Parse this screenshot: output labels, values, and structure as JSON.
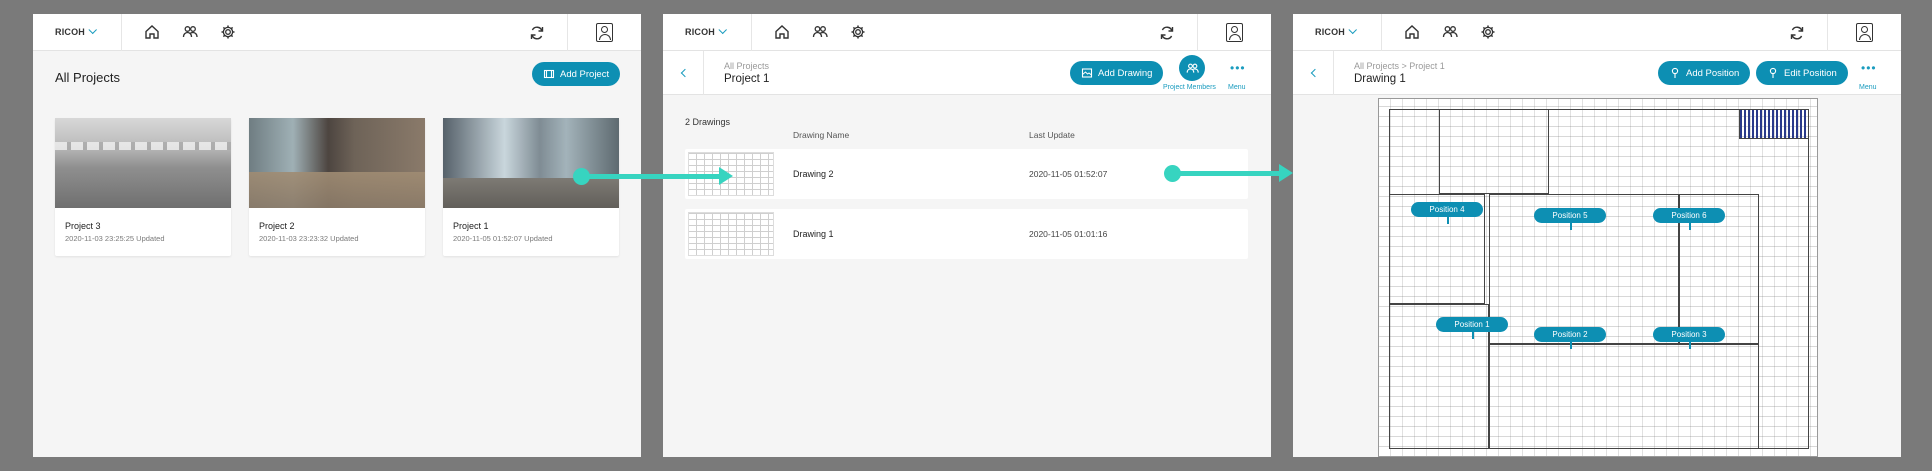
{
  "brand": "RICOH",
  "colors": {
    "accent": "#0d8fb3",
    "arrow": "#37d4c0"
  },
  "screen1": {
    "title": "All Projects",
    "add_project": "Add Project",
    "projects": [
      {
        "name": "Project 3",
        "updated": "2020-11-03 23:25:25 Updated"
      },
      {
        "name": "Project 2",
        "updated": "2020-11-03 23:23:32 Updated"
      },
      {
        "name": "Project 1",
        "updated": "2020-11-05 01:52:07 Updated"
      }
    ]
  },
  "screen2": {
    "breadcrumb": "All Projects",
    "title": "Project 1",
    "add_drawing": "Add Drawing",
    "project_members": "Project Members",
    "menu": "Menu",
    "count": "2 Drawings",
    "col_name": "Drawing Name",
    "col_update": "Last Update",
    "drawings": [
      {
        "name": "Drawing 2",
        "updated": "2020-11-05 01:52:07"
      },
      {
        "name": "Drawing 1",
        "updated": "2020-11-05 01:01:16"
      }
    ]
  },
  "screen3": {
    "breadcrumb": "All Projects > Project 1",
    "title": "Drawing 1",
    "add_position": "Add Position",
    "edit_position": "Edit Position",
    "menu": "Menu",
    "positions": [
      "Position 4",
      "Position 5",
      "Position 6",
      "Position 1",
      "Position 2",
      "Position 3"
    ]
  }
}
